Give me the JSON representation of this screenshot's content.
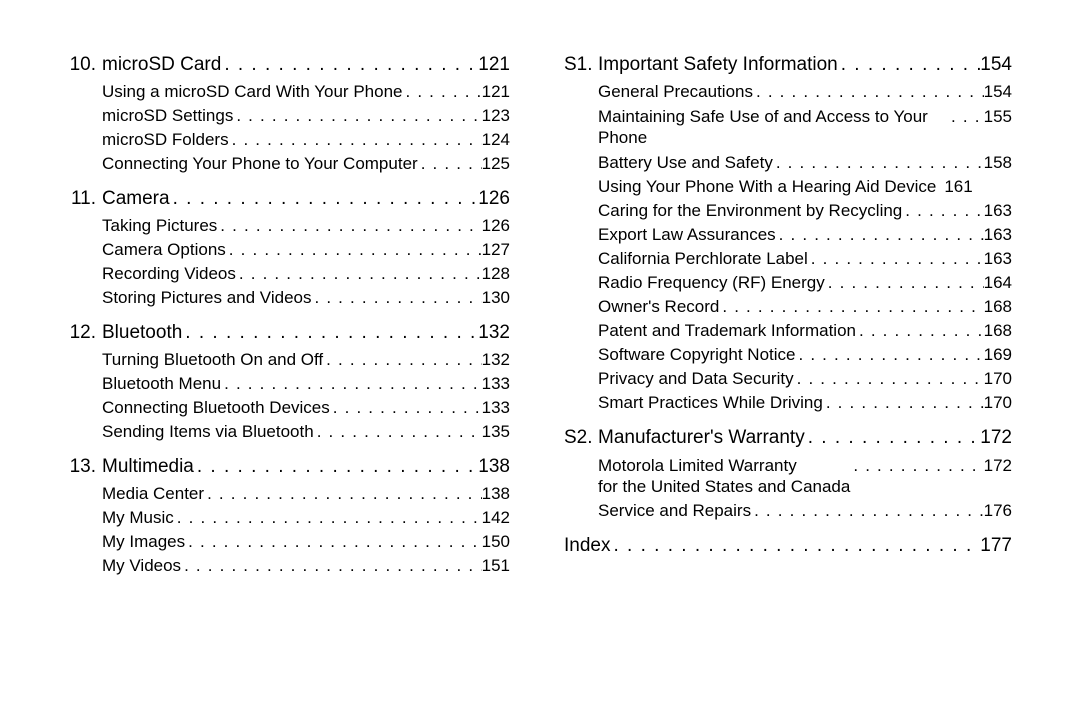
{
  "dots_long": ". . . . . . . . . . . . . . . . . . . . . . . . . . . . . . . . . . . . . . . . . . . . . . . . . . . . . . . . . . . .",
  "left": {
    "chapters": [
      {
        "num": "10.",
        "title": "microSD Card",
        "page": "121",
        "subs": [
          {
            "title": "Using a microSD Card With Your Phone",
            "page": "121"
          },
          {
            "title": "microSD Settings",
            "page": "123"
          },
          {
            "title": "microSD Folders",
            "page": "124"
          },
          {
            "title": "Connecting Your Phone to Your Computer",
            "page": "125"
          }
        ]
      },
      {
        "num": "11.",
        "title": "Camera",
        "page": "126",
        "subs": [
          {
            "title": "Taking Pictures",
            "page": "126"
          },
          {
            "title": "Camera Options",
            "page": "127"
          },
          {
            "title": "Recording Videos",
            "page": "128"
          },
          {
            "title": "Storing Pictures and Videos",
            "page": "130"
          }
        ]
      },
      {
        "num": "12.",
        "title": "Bluetooth",
        "page": "132",
        "subs": [
          {
            "title": "Turning Bluetooth On and Off",
            "page": "132"
          },
          {
            "title": "Bluetooth Menu",
            "page": "133"
          },
          {
            "title": "Connecting Bluetooth Devices",
            "page": "133"
          },
          {
            "title": "Sending Items via Bluetooth",
            "page": "135"
          }
        ]
      },
      {
        "num": "13.",
        "title": "Multimedia",
        "page": "138",
        "subs": [
          {
            "title": "Media Center",
            "page": "138"
          },
          {
            "title": "My Music",
            "page": "142"
          },
          {
            "title": "My Images",
            "page": "150"
          },
          {
            "title": "My Videos",
            "page": "151"
          }
        ]
      }
    ]
  },
  "right": {
    "chapters": [
      {
        "num": "S1.",
        "title": "Important Safety Information",
        "page": "154",
        "subs": [
          {
            "title": "General Precautions",
            "page": "154"
          },
          {
            "title": "Maintaining Safe Use of and Access to Your Phone",
            "page": "155",
            "wrap": true
          },
          {
            "title": "Battery Use and Safety",
            "page": "158"
          },
          {
            "title": "Using Your Phone With a Hearing Aid Device",
            "page": "161",
            "tight": true
          },
          {
            "title": "Caring for the Environment by Recycling",
            "page": "163"
          },
          {
            "title": "Export Law Assurances",
            "page": "163"
          },
          {
            "title": "California Perchlorate Label",
            "page": "163"
          },
          {
            "title": "Radio Frequency (RF) Energy",
            "page": "164"
          },
          {
            "title": "Owner's Record",
            "page": "168"
          },
          {
            "title": "Patent and Trademark Information",
            "page": "168"
          },
          {
            "title": "Software Copyright Notice",
            "page": "169"
          },
          {
            "title": "Privacy and Data Security",
            "page": "170"
          },
          {
            "title": "Smart Practices While Driving",
            "page": "170"
          }
        ]
      },
      {
        "num": "S2.",
        "title": "Manufacturer's Warranty",
        "page": "172",
        "subs": [
          {
            "title": "Motorola Limited Warranty\nfor the United States and Canada",
            "page": "172",
            "wrap": true
          },
          {
            "title": "Service and Repairs",
            "page": "176"
          }
        ]
      }
    ],
    "index": {
      "title": "Index",
      "page": "177"
    }
  }
}
